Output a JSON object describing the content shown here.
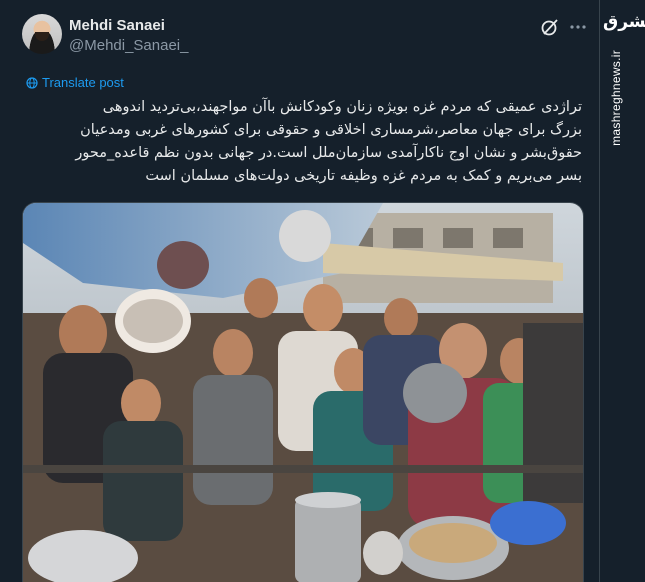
{
  "post": {
    "author_name": "Mehdi Sanaei",
    "author_handle": "@Mehdi_Sanaei_",
    "translate_label": "Translate post",
    "lines": [
      "تراژدی عمیقی که مردم غزه بویژه زنان وکودکانش باآن مواجهند،بی‌تردید اندوهی",
      "بزرگ برای جهان معاصر،شرمساری اخلاقی و حقوقی برای کشورهای غربی ومدعیان",
      "حقوق‌بشر و نشان اوج ناکارآمدی سازمان‌ملل است.در جهانی بدون نظم قاعده_محور",
      "بسر می‌بریم و کمک به مردم غزه وظیفه تاریخی دولت‌های مسلمان است"
    ]
  },
  "icons": {
    "grok": "grok-icon",
    "more": "more-icon",
    "translate": "globe-icon",
    "accent": "#1d9bf0"
  },
  "watermark": {
    "logo": "مشرق",
    "url": "mashreghnews.ir"
  }
}
